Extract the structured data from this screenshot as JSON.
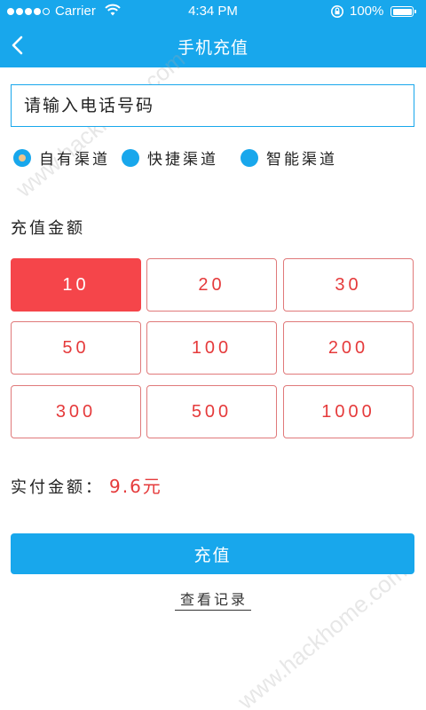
{
  "status_bar": {
    "carrier": "Carrier",
    "time": "4:34 PM",
    "battery": "100%"
  },
  "nav": {
    "title": "手机充值",
    "back_icon": "chevron-left-icon"
  },
  "phone_input": {
    "placeholder": "请输入电话号码",
    "value": ""
  },
  "channels": [
    {
      "label": "自有渠道",
      "selected": true
    },
    {
      "label": "快捷渠道",
      "selected": false
    },
    {
      "label": "智能渠道",
      "selected": false
    }
  ],
  "amount_section": {
    "title": "充值金额",
    "options": [
      "10",
      "20",
      "30",
      "50",
      "100",
      "200",
      "300",
      "500",
      "1000"
    ],
    "selected": "10"
  },
  "actual": {
    "label": "实付金额：",
    "value": "9.6元"
  },
  "recharge_button": "充值",
  "records_link": "查看记录",
  "watermark": "www.hackhome.com",
  "colors": {
    "primary": "#18a7ec",
    "accent_red": "#f5454a",
    "amount_text": "#e53a3b",
    "amount_border": "#e0797a",
    "radio_selected_inner": "#f0c58a"
  }
}
